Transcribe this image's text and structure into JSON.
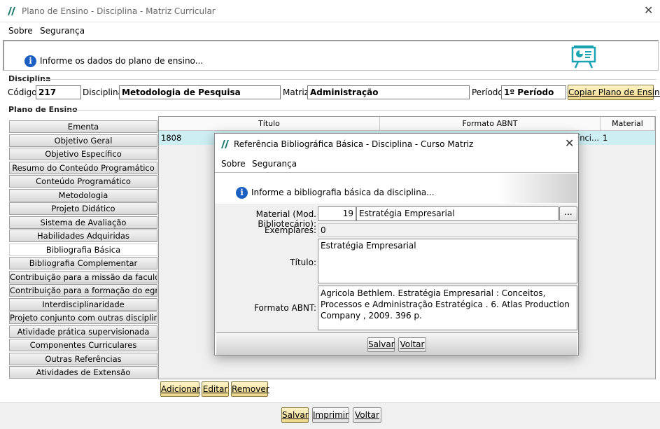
{
  "window": {
    "title": "Plano de Ensino - Disciplina - Matriz Curricular",
    "close": "✕"
  },
  "menu": {
    "sobre": "Sobre",
    "seguranca": "Segurança"
  },
  "info": {
    "message": "Informe os dados do plano de ensino..."
  },
  "disciplina": {
    "section_title": "Disciplina",
    "codigo_label": "Código:",
    "codigo_value": "217",
    "disciplina_label": "Disciplina:",
    "disciplina_value": "Metodologia de Pesquisa",
    "matriz_label": "Matriz:",
    "matriz_value": "Administração",
    "periodo_label": "Período:",
    "periodo_value": "1º Período",
    "copiar_button": "Copiar Plano de Ensino"
  },
  "plano": {
    "section_title": "Plano de Ensino",
    "tabs": [
      "Ementa",
      "Objetivo Geral",
      "Objetivo Específico",
      "Resumo do Conteúdo Programático",
      "Conteúdo Programático",
      "Metodologia",
      "Projeto Didático",
      "Sistema de Avaliação",
      "Habilidades Adquiridas",
      "Bibliografia Básica",
      "Bibliografia Complementar",
      "Contribuição para a missão da faculdade",
      "Contribuição para a formação do egresso",
      "Interdisciplinaridade",
      "Projeto conjunto com outras disciplinas",
      "Atividade prática supervisionada",
      "Componentes Curriculares",
      "Outras Referências",
      "Atividades de Extensão"
    ],
    "active_tab": "Bibliografia Básica"
  },
  "grid": {
    "columns": [
      "Título",
      "Formato ABNT",
      "Material"
    ],
    "row": {
      "id": "1808",
      "formato_fragment": "ínci...",
      "material": "1"
    }
  },
  "grid_buttons": {
    "adicionar": "Adicionar",
    "editar": "Editar",
    "remover": "Remover"
  },
  "footer_buttons": {
    "salvar": "Salvar",
    "imprimir": "Imprimir",
    "voltar": "Voltar"
  },
  "dialog": {
    "title": "Referência Bibliográfica Básica - Disciplina - Curso Matriz",
    "close": "✕",
    "menu": {
      "sobre": "Sobre",
      "seguranca": "Segurança"
    },
    "info": "Informe a bibliografia básica da disciplina...",
    "material_label": "Material (Mod. Bibliotecário):",
    "material_code": "19",
    "material_name": "Estratégia Empresarial",
    "lookup_button": "...",
    "exemplares_label": "Exemplares:",
    "exemplares_value": "0",
    "titulo_label": "Título:",
    "titulo_value": "Estratégia Empresarial",
    "abnt_label": "Formato ABNT:",
    "abnt_value": "Agricola Bethlem. Estratégia Empresarial : Conceitos, Processos e Administração Estratégica . 6. Atlas Production Company , 2009. 396 p.",
    "salvar": "Salvar",
    "voltar": "Voltar"
  }
}
